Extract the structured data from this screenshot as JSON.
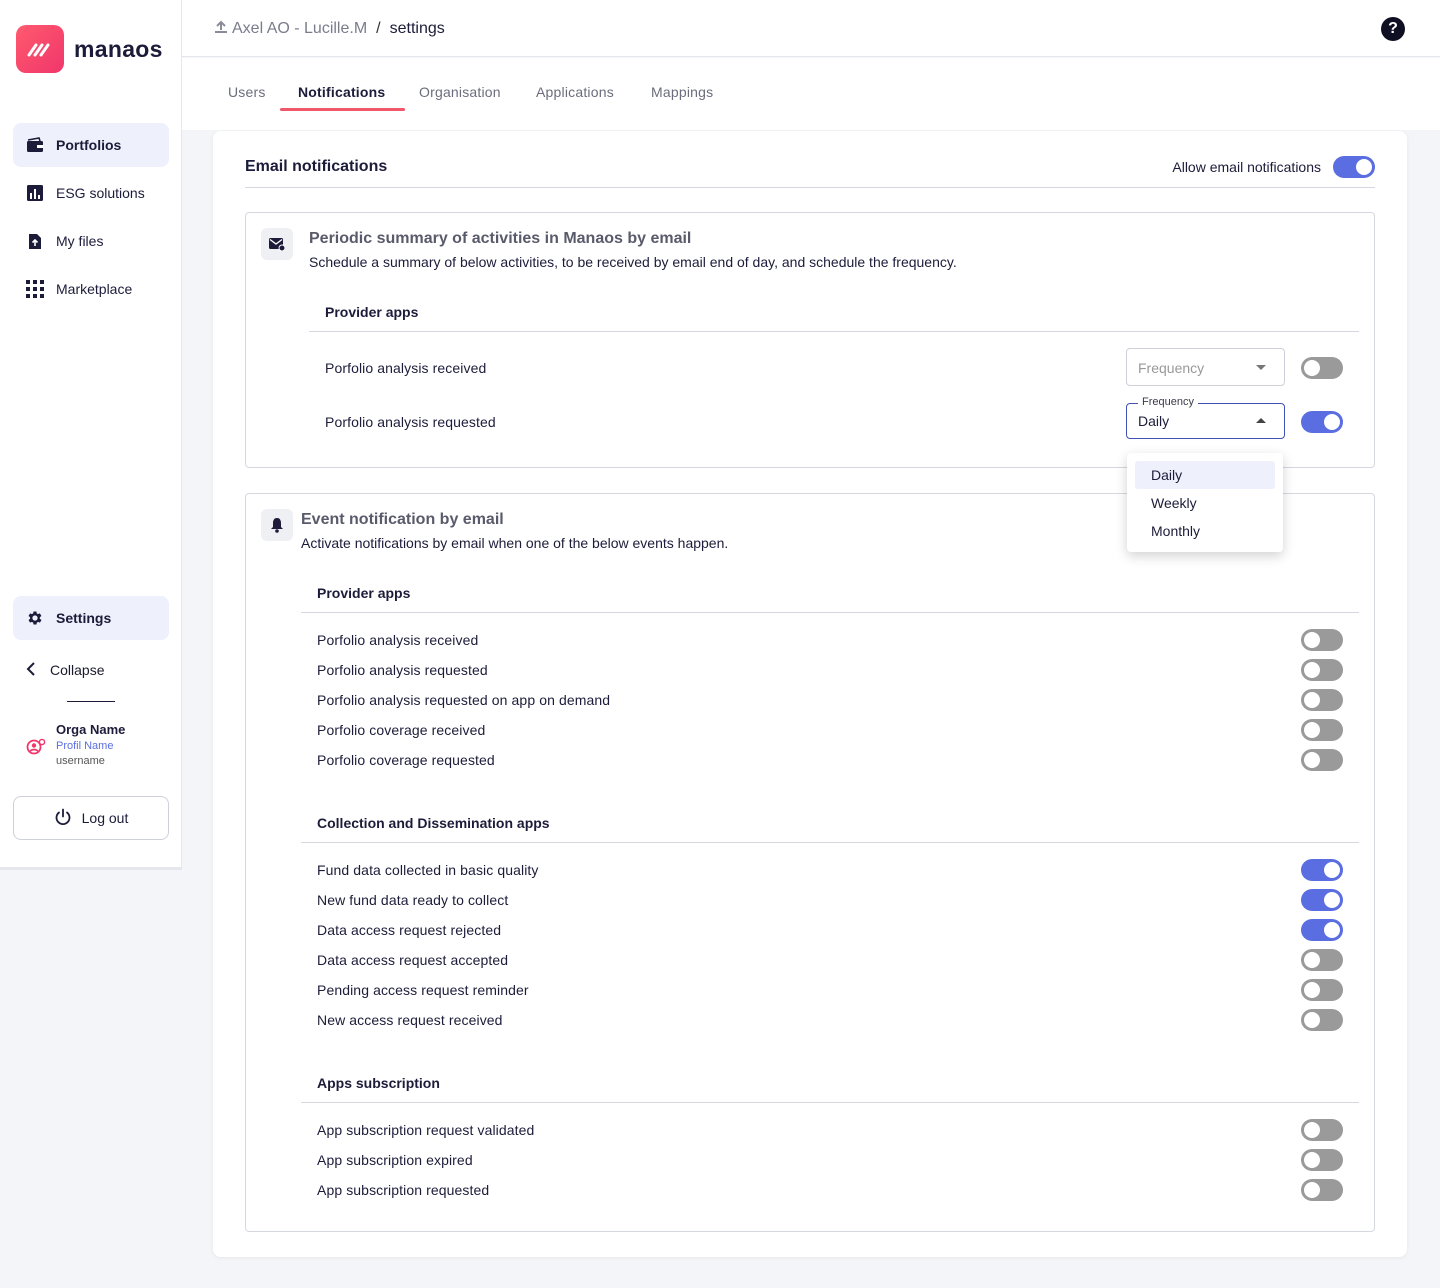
{
  "brand": {
    "name": "manaos",
    "accent": "#f0366b",
    "toggle_on": "#5b6ee1"
  },
  "sidebar": {
    "items": [
      {
        "label": "Portfolios",
        "icon": "wallet-icon",
        "active": true
      },
      {
        "label": "ESG solutions",
        "icon": "bar-chart-icon",
        "active": false
      },
      {
        "label": "My files",
        "icon": "file-upload-icon",
        "active": false
      },
      {
        "label": "Marketplace",
        "icon": "grid-icon",
        "active": false
      }
    ],
    "settings_label": "Settings",
    "collapse_label": "Collapse",
    "org_name": "Orga Name",
    "profil_name": "Profil Name",
    "username": "username",
    "logout_label": "Log out"
  },
  "header": {
    "breadcrumb_parent": "Axel AO - Lucille.M",
    "breadcrumb_sep": "/",
    "breadcrumb_current": "settings",
    "help_label": "?"
  },
  "tabs": [
    "Users",
    "Notifications",
    "Organisation",
    "Applications",
    "Mappings"
  ],
  "active_tab": "Notifications",
  "card": {
    "title": "Email notifications",
    "allow_label": "Allow email notifications",
    "allow_enabled": true
  },
  "periodic": {
    "title": "Periodic summary of activities in Manaos by email",
    "description": "Schedule a summary of below activities, to be received by email end of day, and schedule the frequency.",
    "group_title": "Provider apps",
    "rows": [
      {
        "label": "Porfolio analysis received",
        "frequency_placeholder": "Frequency",
        "enabled": false
      },
      {
        "label": "Porfolio analysis requested",
        "frequency_label": "Frequency",
        "frequency_value": "Daily",
        "enabled": true
      }
    ],
    "dropdown_options": [
      "Daily",
      "Weekly",
      "Monthly"
    ],
    "dropdown_selected": "Daily"
  },
  "events": {
    "title": "Event notification by email",
    "description": "Activate notifications by email when one of the below events happen.",
    "groups": [
      {
        "title": "Provider apps",
        "rows": [
          {
            "label": "Porfolio analysis received",
            "enabled": false
          },
          {
            "label": "Porfolio analysis requested",
            "enabled": false
          },
          {
            "label": "Porfolio analysis requested on app on demand",
            "enabled": false
          },
          {
            "label": "Porfolio coverage received",
            "enabled": false
          },
          {
            "label": "Porfolio coverage requested",
            "enabled": false
          }
        ]
      },
      {
        "title": "Collection and Dissemination apps",
        "rows": [
          {
            "label": "Fund data collected in basic quality",
            "enabled": true
          },
          {
            "label": "New fund data ready to collect",
            "enabled": true
          },
          {
            "label": "Data access request rejected",
            "enabled": true
          },
          {
            "label": "Data access request accepted",
            "enabled": false
          },
          {
            "label": "Pending access request reminder",
            "enabled": false
          },
          {
            "label": "New access request received",
            "enabled": false
          }
        ]
      },
      {
        "title": "Apps subscription",
        "rows": [
          {
            "label": "App subscription request validated",
            "enabled": false
          },
          {
            "label": "App subscription expired",
            "enabled": false
          },
          {
            "label": "App subscription requested",
            "enabled": false
          }
        ]
      }
    ]
  }
}
